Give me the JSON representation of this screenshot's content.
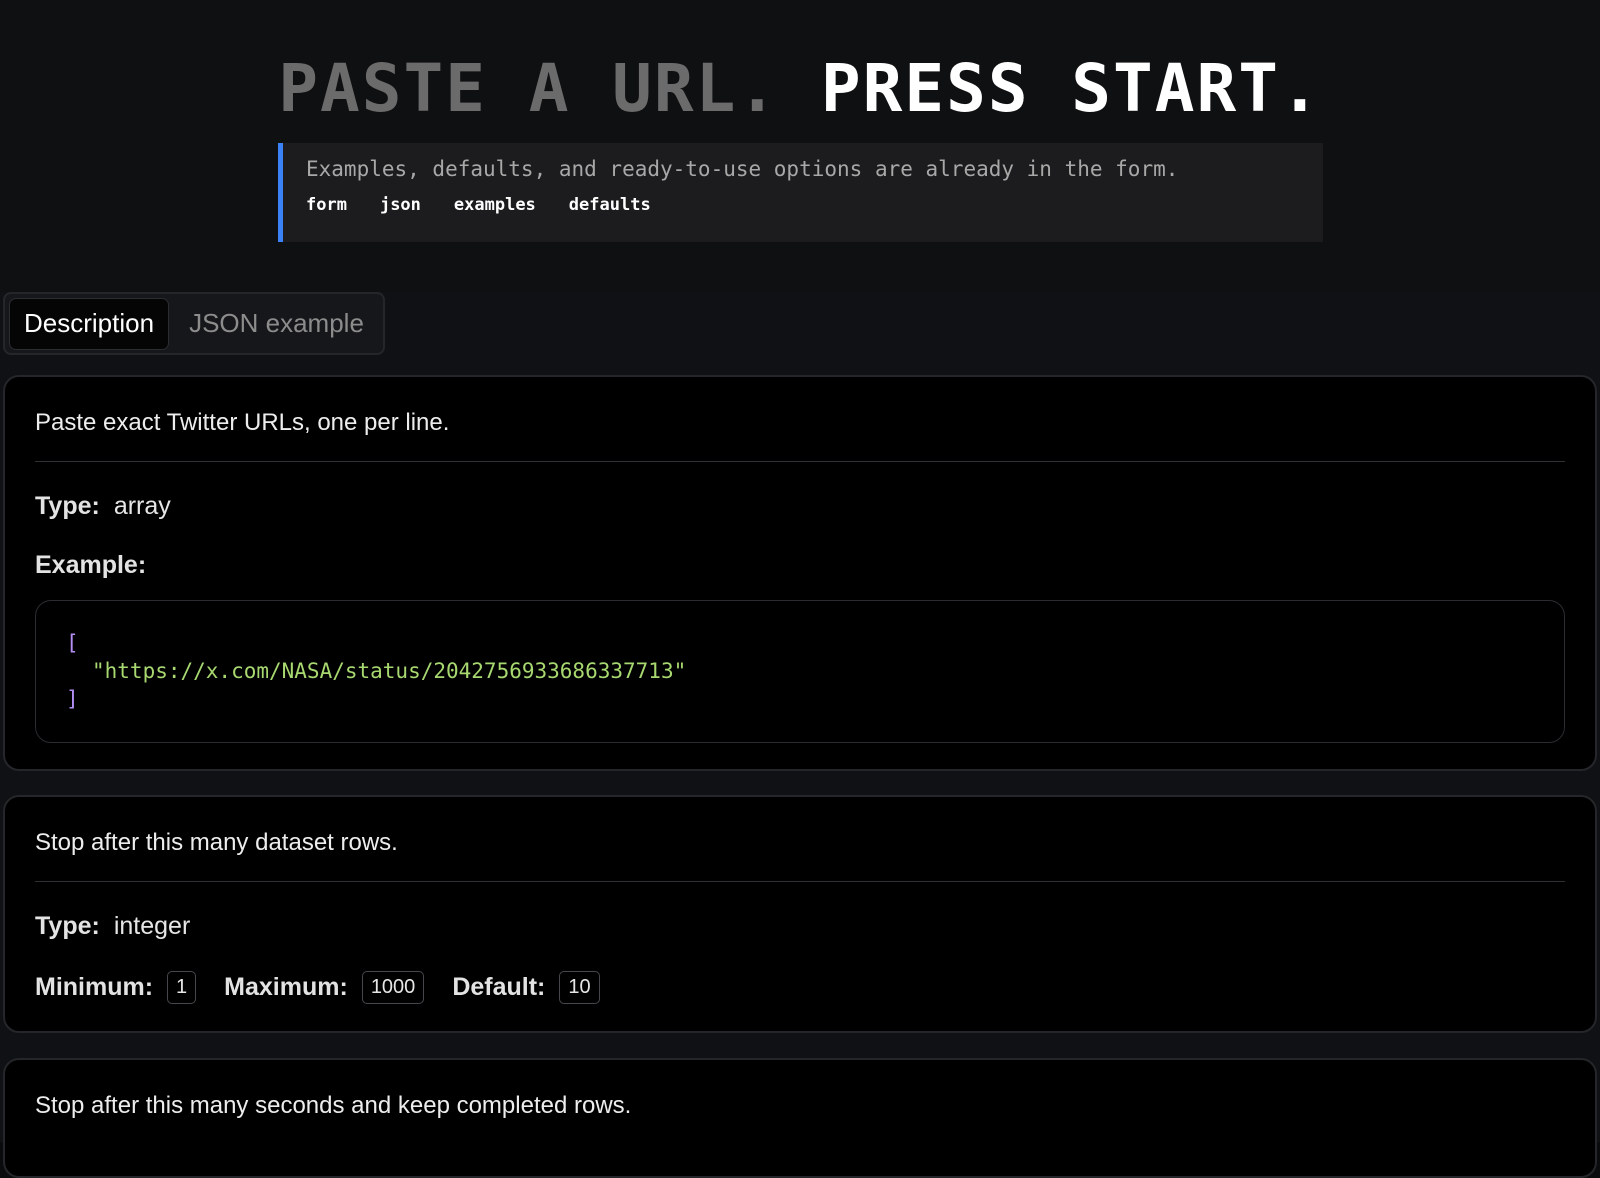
{
  "hero": {
    "title_dim": "PASTE A URL.",
    "title_bright": "PRESS START.",
    "callout_text": "Examples, defaults, and ready-to-use options are already in the form.",
    "tags": [
      "form",
      "json",
      "examples",
      "defaults"
    ],
    "accent_color": "#3b82f6"
  },
  "tabs": {
    "description_label": "Description",
    "json_label": "JSON example"
  },
  "fields": [
    {
      "description": "Paste exact Twitter URLs, one per line.",
      "type_label": "Type:",
      "type_value": "array",
      "example_label": "Example:",
      "example_open": "[",
      "example_value": "\"https://x.com/NASA/status/2042756933686337713\"",
      "example_close": "]"
    },
    {
      "description": "Stop after this many dataset rows.",
      "type_label": "Type:",
      "type_value": "integer",
      "minimum_label": "Minimum:",
      "minimum_value": "1",
      "maximum_label": "Maximum:",
      "maximum_value": "1000",
      "default_label": "Default:",
      "default_value": "10"
    },
    {
      "description": "Stop after this many seconds and keep completed rows."
    }
  ]
}
